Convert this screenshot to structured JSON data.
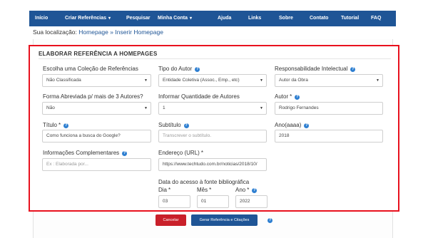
{
  "nav": {
    "items": [
      {
        "label": "Início",
        "dropdown": false
      },
      {
        "label": "Criar Referências",
        "dropdown": true
      },
      {
        "label": "Pesquisar",
        "dropdown": false
      },
      {
        "label": "Minha Conta",
        "dropdown": true
      },
      {
        "label": "Ajuda",
        "dropdown": false
      },
      {
        "label": "Links",
        "dropdown": false
      },
      {
        "label": "Sobre",
        "dropdown": false
      },
      {
        "label": "Contato",
        "dropdown": false
      },
      {
        "label": "Tutorial",
        "dropdown": false
      },
      {
        "label": "FAQ",
        "dropdown": false
      }
    ],
    "caret": "▾"
  },
  "breadcrumb": {
    "prefix": "Sua localização:",
    "home": "Homepage",
    "separator": "»",
    "current": "Inserir Homepage"
  },
  "form": {
    "legend": "ELABORAR REFERÊNCIA A HOMEPAGES",
    "colecao": {
      "label": "Escolha uma Coleção de Referências",
      "value": "Não Classificada"
    },
    "tipo_autor": {
      "label": "Tipo do Autor",
      "value": "Entidade Coletiva (Assoc., Emp., etc)"
    },
    "responsabilidade": {
      "label": "Responsabilidade Intelectual",
      "value": "Autor da Obra"
    },
    "forma_abreviada": {
      "label": "Forma Abreviada p/ mais de 3 Autores?",
      "value": "Não"
    },
    "qtd_autores": {
      "label": "Informar Quantidade de Autores",
      "value": "1"
    },
    "autor": {
      "label": "Autor",
      "value": "Rodrigo Fernandes"
    },
    "titulo": {
      "label": "Título",
      "value": "Como funciona a busca do Google?"
    },
    "subtitulo": {
      "label": "Subtítulo",
      "placeholder": "Transcrever o subtítulo."
    },
    "ano": {
      "label": "Ano(aaaa)",
      "value": "2018"
    },
    "info_compl": {
      "label": "Informações Complementares",
      "placeholder": "Ex : Elaborada por..."
    },
    "url": {
      "label": "Endereço (URL)",
      "value": "https://www.techtudo.com.br/noticias/2018/10/"
    },
    "data_acesso": {
      "label": "Data do acesso à fonte bibliográfica"
    },
    "dia": {
      "label": "Dia",
      "value": "03"
    },
    "mes": {
      "label": "Mês",
      "value": "01"
    },
    "ano_acesso": {
      "label": "Ano",
      "value": "2022"
    },
    "required_mark": "*",
    "help_glyph": "?"
  },
  "buttons": {
    "cancel": "Cancelar",
    "generate": "Gerar Referência e Citações"
  },
  "colors": {
    "navbar": "#1f5596",
    "highlight_border": "#e8111e",
    "cancel": "#c9202a",
    "help": "#2e7fd1"
  }
}
